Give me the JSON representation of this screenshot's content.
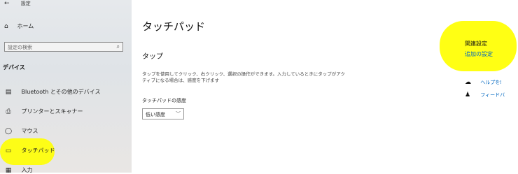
{
  "window": {
    "back_icon": "←",
    "title": "設定"
  },
  "sidebar": {
    "home_label": "ホーム",
    "search_placeholder": "設定の検索",
    "section_title": "デバイス",
    "items": [
      {
        "label": "Bluetooth とその他のデバイス",
        "icon": "bluetooth-devices-icon"
      },
      {
        "label": "プリンターとスキャナー",
        "icon": "printer-icon"
      },
      {
        "label": "マウス",
        "icon": "mouse-icon"
      },
      {
        "label": "タッチパッド",
        "icon": "touchpad-icon",
        "selected": true
      },
      {
        "label": "入力",
        "icon": "keyboard-icon"
      }
    ]
  },
  "main": {
    "title": "タッチパッド",
    "section": "タップ",
    "description": "タップを使用してクリック、右クリック、選択の操作ができます。入力しているときにタップがアクティブになる場合は、感度を下げます",
    "sensitivity_label": "タッチパッドの感度",
    "sensitivity_value": "低い感度"
  },
  "related": {
    "title": "関連設定",
    "link": "追加の設定",
    "help": "ヘルプを!",
    "feedback": "フィードバ"
  },
  "colors": {
    "accent": "#0067c0",
    "highlight": "#ffff00",
    "sidebar_bg": "#e3e6e9"
  }
}
